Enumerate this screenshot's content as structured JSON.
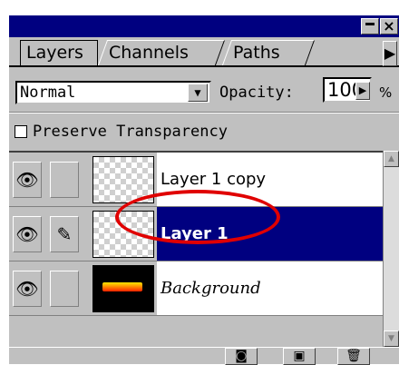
{
  "tabs": [
    {
      "label": "Layers",
      "active": true
    },
    {
      "label": "Channels",
      "active": false
    },
    {
      "label": "Paths",
      "active": false
    }
  ],
  "blend_mode": "Normal",
  "opacity_label": "Opacity:",
  "opacity_value": "100",
  "opacity_unit": "%",
  "preserve_transparency_label": "Preserve Transparency",
  "preserve_transparency_checked": false,
  "layers": [
    {
      "name": "Layer 1 copy",
      "visible": true,
      "selected": false,
      "italic": false
    },
    {
      "name": "Layer 1",
      "visible": true,
      "selected": true,
      "italic": false
    },
    {
      "name": "Background",
      "visible": true,
      "selected": false,
      "italic": true
    }
  ],
  "colors": {
    "panel_bg": "#c0c0c0",
    "selected_bg": "#000080",
    "highlight_ellipse": "#e00000"
  },
  "icons": [
    "eye-icon",
    "brush-icon",
    "new-layer-mask-icon",
    "new-layer-icon",
    "trash-icon",
    "panel-menu-arrow-icon"
  ]
}
